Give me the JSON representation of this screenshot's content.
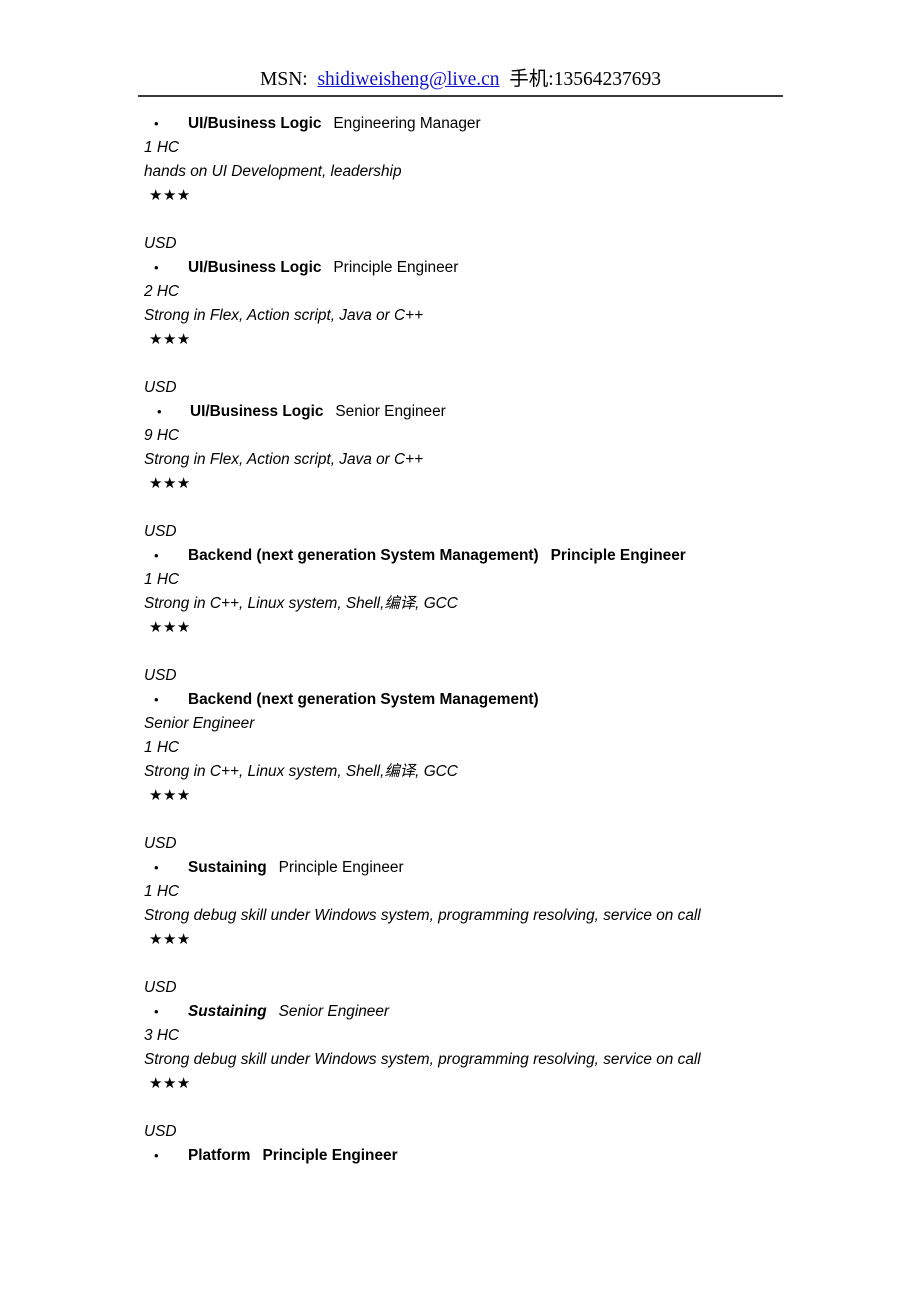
{
  "header": {
    "msn_label": "MSN:",
    "email": "shidiweisheng@live.cn",
    "phone": "手机:13564237693"
  },
  "stars_glyph": "★★★",
  "currency": "USD",
  "entries": [
    {
      "department": "UI/Business Logic",
      "role": "Engineering Manager",
      "headcount": "1 HC",
      "requirement": "hands on UI Development, leadership",
      "rating": "★★★",
      "currency": "USD",
      "style": "bold-dept",
      "role_on_own_line": false
    },
    {
      "department": "UI/Business Logic",
      "role": "Principle Engineer",
      "headcount": "2 HC",
      "requirement": "Strong in Flex, Action script, Java or C++",
      "rating": "★★★",
      "currency": "USD",
      "style": "bold-dept",
      "role_on_own_line": false
    },
    {
      "department": "UI/Business Logic",
      "role": "Senior Engineer",
      "headcount": "9 HC",
      "requirement": "Strong in Flex, Action script, Java or C++",
      "rating": "★★★",
      "currency": "USD",
      "style": "bold-dept-wide",
      "role_on_own_line": false
    },
    {
      "department": "Backend (next generation System Management)",
      "role": "Principle Engineer",
      "headcount": "1 HC",
      "requirement": "Strong in C++, Linux system, Shell,编译, GCC",
      "rating": "★★★",
      "currency": "USD",
      "style": "both-bold",
      "role_on_own_line": false
    },
    {
      "department": "Backend (next generation System Management)",
      "role": "Senior Engineer",
      "headcount": "1 HC",
      "requirement": "Strong in C++, Linux system, Shell,编译, GCC",
      "rating": "★★★",
      "currency": "USD",
      "style": "both-bold",
      "role_on_own_line": true
    },
    {
      "department": "Sustaining",
      "role": "Principle Engineer",
      "headcount": "1 HC",
      "requirement": "Strong debug skill under Windows system, programming resolving, service on call",
      "rating": "★★★",
      "currency": "USD",
      "style": "bold-dept",
      "role_on_own_line": false
    },
    {
      "department": "Sustaining",
      "role": "Senior Engineer",
      "headcount": "3 HC",
      "requirement": "Strong debug skill under Windows system, programming resolving, service on call",
      "rating": "★★★",
      "currency": "USD",
      "style": "bold-italic-dept",
      "role_on_own_line": false
    },
    {
      "department": "Platform",
      "role": "Principle Engineer",
      "headcount": null,
      "requirement": null,
      "rating": null,
      "currency": null,
      "style": "both-bold",
      "role_on_own_line": false
    }
  ]
}
